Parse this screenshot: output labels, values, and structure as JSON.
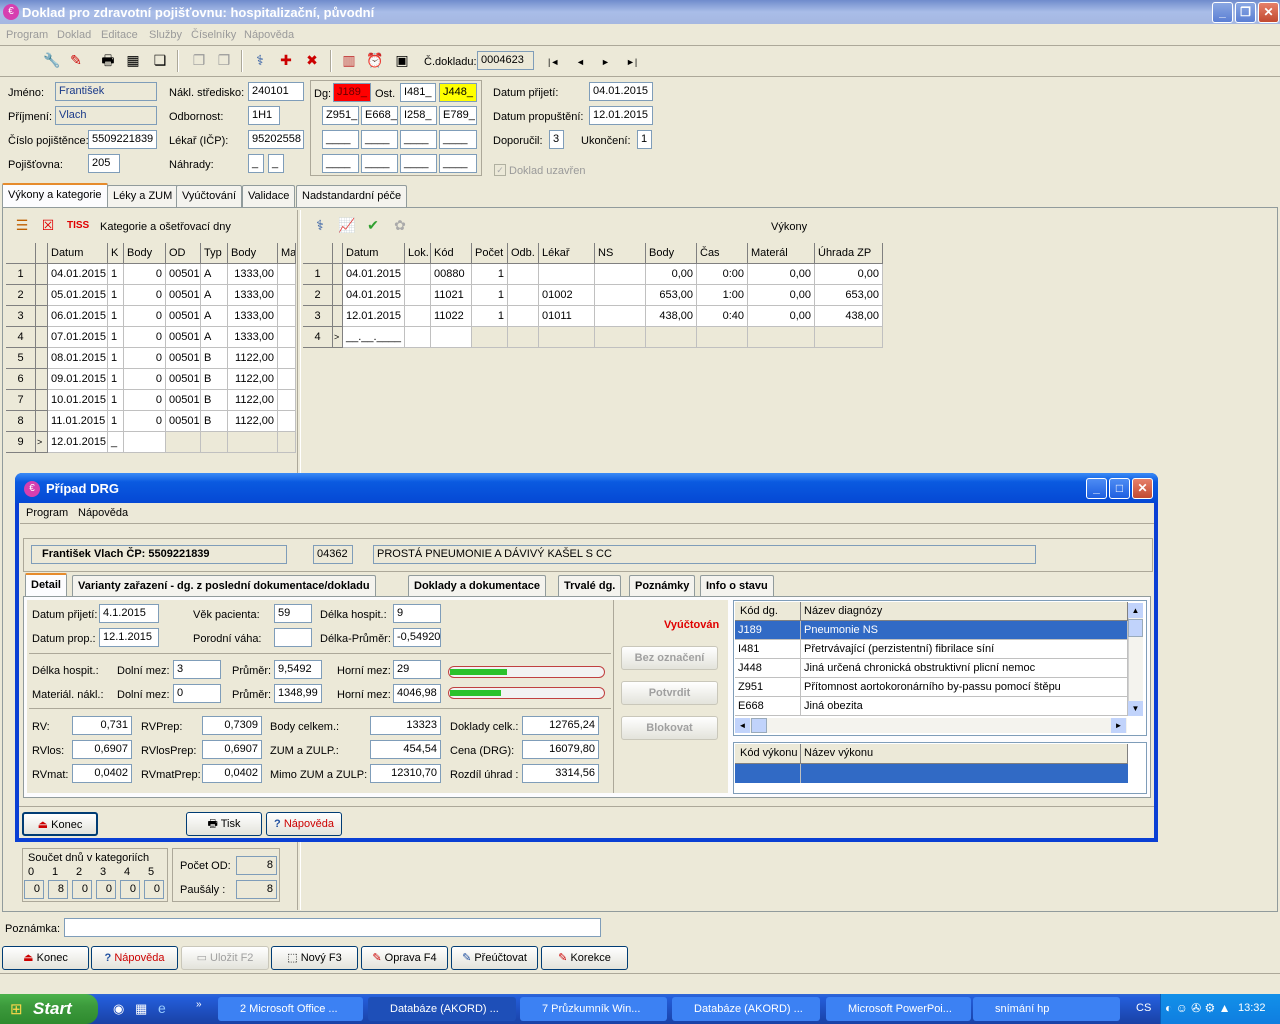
{
  "main_window": {
    "title": "Doklad pro zdravotní pojišťovnu: hospitalizační, původní",
    "menu": [
      "Program",
      "Doklad",
      "Editace",
      "Služby",
      "Číselníky",
      "Nápověda"
    ],
    "doc_label": "Č.dokladu:",
    "doc_number": "0004623",
    "nav": [
      "|◄",
      "◄",
      "►",
      "►|"
    ]
  },
  "header": {
    "jmeno_label": "Jméno:",
    "jmeno": "František",
    "prijmeni_label": "Příjmení:",
    "prijmeni": "Vlach",
    "cislo_label": "Číslo pojištěnce:",
    "cislo": "5509221839",
    "pojistovna_label": "Pojišťovna:",
    "pojistovna": "205",
    "nakl_label": "Nákl. středisko:",
    "nakl": "240101",
    "odbornost_label": "Odbornost:",
    "odbornost": "1H1",
    "lekar_label": "Lékař (IČP):",
    "lekar": "95202558",
    "nahrady_label": "Náhrady:",
    "nahrady1": "_",
    "nahrady2": "_",
    "dg_label": "Dg:",
    "dg": "J189_",
    "ost_label": "Ost.",
    "ost1": "I481_",
    "ost2": "J448_",
    "row2": [
      "Z951_",
      "E668_",
      "I258_",
      "E789_"
    ],
    "row3": [
      "____",
      "____",
      "____",
      "____"
    ],
    "row4": [
      "____",
      "____",
      "____",
      "____"
    ],
    "prijeti_label": "Datum přijetí:",
    "prijeti": "04.01.2015",
    "propusteni_label": "Datum propuštění:",
    "propusteni": "12.01.2015",
    "doporucil_label": "Doporučil:",
    "doporucil": "3",
    "ukonceni_label": "Ukončení:",
    "ukonceni": "1",
    "uzavren_label": "Doklad uzavřen"
  },
  "tabs": [
    "Výkony a kategorie",
    "Léky a ZUM",
    "Vyúčtování",
    "Validace",
    "Nadstandardní péče"
  ],
  "left_panel": {
    "label": "Kategorie a ošetřovací dny",
    "tiss": "TISS",
    "columns": [
      "Datum",
      "K",
      "Body",
      "OD",
      "Typ",
      "Body",
      "Ma"
    ],
    "rows": [
      [
        "1",
        "04.01.2015",
        "1",
        "0",
        "00501",
        "A",
        "1333,00"
      ],
      [
        "2",
        "05.01.2015",
        "1",
        "0",
        "00501",
        "A",
        "1333,00"
      ],
      [
        "3",
        "06.01.2015",
        "1",
        "0",
        "00501",
        "A",
        "1333,00"
      ],
      [
        "4",
        "07.01.2015",
        "1",
        "0",
        "00501",
        "A",
        "1333,00"
      ],
      [
        "5",
        "08.01.2015",
        "1",
        "0",
        "00501",
        "B",
        "1122,00"
      ],
      [
        "6",
        "09.01.2015",
        "1",
        "0",
        "00501",
        "B",
        "1122,00"
      ],
      [
        "7",
        "10.01.2015",
        "1",
        "0",
        "00501",
        "B",
        "1122,00"
      ],
      [
        "8",
        "11.01.2015",
        "1",
        "0",
        "00501",
        "B",
        "1122,00"
      ],
      [
        "9",
        "12.01.2015",
        "_",
        "",
        "",
        "",
        ""
      ]
    ]
  },
  "right_panel": {
    "label": "Výkony",
    "columns": [
      "Datum",
      "Lok.",
      "Kód",
      "Počet",
      "Odb.",
      "Lékař",
      "NS",
      "Body",
      "Čas",
      "Materál",
      "Úhrada ZP"
    ],
    "rows": [
      [
        "1",
        "04.01.2015",
        "",
        "00880",
        "1",
        "",
        "",
        "",
        "0,00",
        "0:00",
        "0,00",
        "0,00"
      ],
      [
        "2",
        "04.01.2015",
        "",
        "11021",
        "1",
        "",
        "01002",
        "",
        "653,00",
        "1:00",
        "0,00",
        "653,00"
      ],
      [
        "3",
        "12.01.2015",
        "",
        "11022",
        "1",
        "",
        "01011",
        "",
        "438,00",
        "0:40",
        "0,00",
        "438,00"
      ],
      [
        "4",
        "__.__.____",
        "",
        "",
        "",
        "",
        "",
        "",
        "",
        "",
        "",
        ""
      ]
    ]
  },
  "bottom_summary": {
    "soucet_label": "Součet dnů v kategoriích",
    "cat_nums": [
      "0",
      "1",
      "2",
      "3",
      "4",
      "5"
    ],
    "cat_vals": [
      "0",
      "8",
      "0",
      "0",
      "0",
      "0"
    ],
    "pocet_od_label": "Počet OD:",
    "pocet_od": "8",
    "pausaly_label": "Paušály :",
    "pausaly": "8",
    "poznamka_label": "Poznámka:"
  },
  "bottom_buttons": [
    "Konec",
    "Nápověda",
    "Uložit  F2",
    "Nový  F3",
    "Oprava  F4",
    "Přeúčtovat",
    "Korekce"
  ],
  "drg_dialog": {
    "title": "Případ DRG",
    "menu": [
      "Program",
      "Nápověda"
    ],
    "patient": "František Vlach  ČP: 5509221839",
    "code": "04362",
    "diagnosis_desc": "PROSTÁ PNEUMONIE A DÁVIVÝ KAŠEL S CC",
    "tabs": [
      "Detail",
      "Varianty zařazení - dg. z poslední dokumentace/dokladu",
      "Doklady a dokumentace",
      "Trvalé dg.",
      "Poznámky",
      "Info o stavu"
    ],
    "datum_prijeti_label": "Datum přijetí:",
    "datum_prijeti": "4.1.2015",
    "datum_prop_label": "Datum prop.:",
    "datum_prop": "12.1.2015",
    "vek_label": "Věk pacienta:",
    "vek": "59",
    "porodni_label": "Porodní váha:",
    "porodni": "",
    "delka_label": "Délka hospit.:",
    "delka": "9",
    "delka_prumer_label": "Délka-Průměr:",
    "delka_prumer": "-0,54920",
    "h_delka_label": "Délka hospit.:",
    "h_dolni_label": "Dolní mez:",
    "h_dolni": "3",
    "h_prumer_label": "Průměr:",
    "h_prumer": "9,5492",
    "h_horni_label": "Horní mez:",
    "h_horni": "29",
    "h_fill": 0.37,
    "m_label": "Materiál. nákl.:",
    "m_dolni_label": "Dolní mez:",
    "m_dolni": "0",
    "m_prumer_label": "Průměr:",
    "m_prumer": "1348,99",
    "m_horni_label": "Horní mez:",
    "m_horni": "4046,98",
    "m_fill": 0.33,
    "rv_label": "RV:",
    "rv": "0,731",
    "rvprep_label": "RVPrep:",
    "rvprep": "0,7309",
    "rvlos_label": "RVlos:",
    "rvlos": "0,6907",
    "rvlosprep_label": "RVlosPrep:",
    "rvlosprep": "0,6907",
    "rvmat_label": "RVmat:",
    "rvmat": "0,0402",
    "rvmatprep_label": "RVmatPrep:",
    "rvmatprep": "0,0402",
    "body_label": "Body celkem.:",
    "body": "13323",
    "zum_label": "ZUM a ZULP.:",
    "zum": "454,54",
    "mimo_label": "Mimo ZUM a ZULP:",
    "mimo": "12310,70",
    "doklady_label": "Doklady celk.:",
    "doklady": "12765,24",
    "cena_label": "Cena (DRG):",
    "cena": "16079,80",
    "rozdil_label": "Rozdíl úhrad :",
    "rozdil": "3314,56",
    "status": "Vyúčtován",
    "side_buttons": [
      "Bez označení",
      "Potvrdit",
      "Blokovat"
    ],
    "dg_cols": [
      "Kód dg.",
      "Název diagnózy"
    ],
    "dg_rows": [
      [
        "J189",
        "Pneumonie NS"
      ],
      [
        "I481",
        "Přetrvávající (perzistentní) fibrilace síní"
      ],
      [
        "J448",
        "Jiná určená chronická obstruktivní plicní nemoc"
      ],
      [
        "Z951",
        "Přítomnost aortokoronárního by-passu pomocí štěpu"
      ],
      [
        "E668",
        "Jiná obezita"
      ]
    ],
    "vyk_cols": [
      "Kód výkonu",
      "Název výkonu"
    ],
    "buttons": [
      "Konec",
      "Tisk",
      "Nápověda"
    ]
  },
  "taskbar": {
    "start": "Start",
    "tasks": [
      "2 Microsoft Office ...",
      "Databáze (AKORD) ...",
      "7 Průzkumník Win...",
      "Databáze (AKORD) ...",
      "Microsoft PowerPoi...",
      "snímání hp"
    ],
    "lang": "CS",
    "clock": "13:32"
  }
}
